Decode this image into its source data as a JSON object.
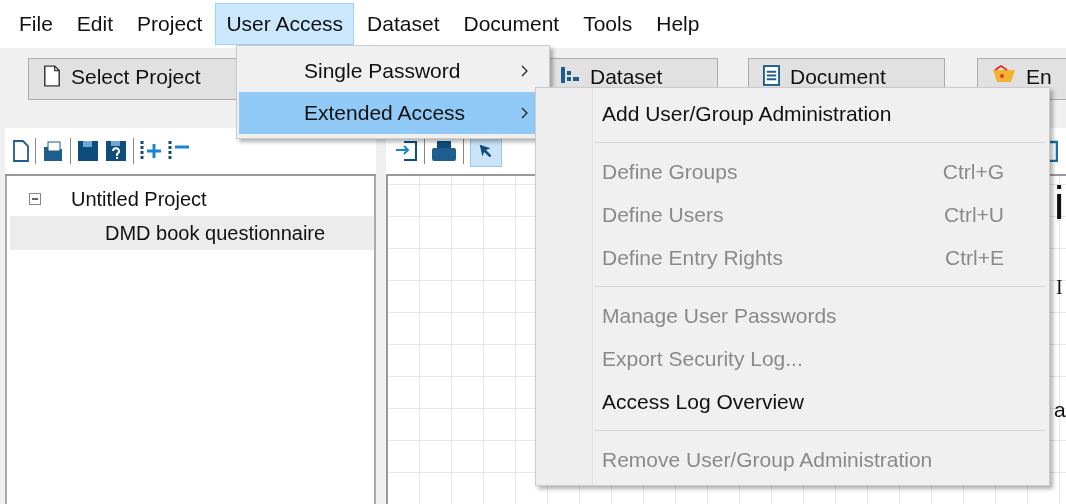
{
  "menu_bar": [
    {
      "label": "File",
      "selected": false
    },
    {
      "label": "Edit",
      "selected": false
    },
    {
      "label": "Project",
      "selected": false
    },
    {
      "label": "User Access",
      "selected": true
    },
    {
      "label": "Dataset",
      "selected": false
    },
    {
      "label": "Document",
      "selected": false
    },
    {
      "label": "Tools",
      "selected": false
    },
    {
      "label": "Help",
      "selected": false
    }
  ],
  "toolbar": [
    {
      "kind": "page",
      "label": "Select Project"
    },
    {
      "kind": "grid",
      "label": "Dataset"
    },
    {
      "kind": "document",
      "label": "Document"
    },
    {
      "kind": "palette",
      "label": "En"
    }
  ],
  "tree": {
    "label": "Untitled Project",
    "expanded": true,
    "children": [
      {
        "label": "DMD book questionnaire",
        "selected": true
      }
    ]
  },
  "canvas_texts": [
    {
      "kind": "heading",
      "text": "i"
    },
    {
      "kind": "label",
      "text": "I"
    },
    {
      "kind": "text",
      "text": "a"
    }
  ],
  "user_access_menu": [
    {
      "label": "Single Password",
      "selected": false
    },
    {
      "label": "Extended Access",
      "selected": true
    }
  ],
  "extended_access_menu": [
    {
      "kind": "item",
      "label": "Add User/Group Administration",
      "disabled": false
    },
    {
      "kind": "separator"
    },
    {
      "kind": "item",
      "label": "Define Groups",
      "shortcut": "Ctrl+G",
      "disabled": true
    },
    {
      "kind": "item",
      "label": "Define Users",
      "shortcut": "Ctrl+U",
      "disabled": true
    },
    {
      "kind": "item",
      "label": "Define Entry Rights",
      "shortcut": "Ctrl+E",
      "disabled": true
    },
    {
      "kind": "separator"
    },
    {
      "kind": "item",
      "label": "Manage User Passwords",
      "disabled": true
    },
    {
      "kind": "item",
      "label": "Export Security Log...",
      "disabled": true
    },
    {
      "kind": "item",
      "label": "Access Log Overview",
      "disabled": false
    },
    {
      "kind": "separator"
    },
    {
      "kind": "item",
      "label": "Remove User/Group Administration",
      "disabled": true
    }
  ]
}
